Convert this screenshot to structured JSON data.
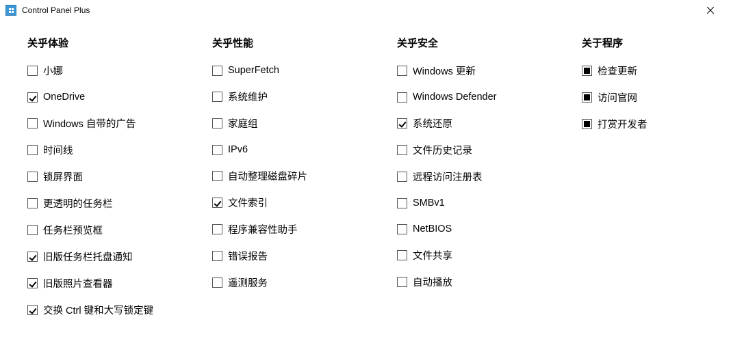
{
  "window": {
    "title": "Control Panel Plus"
  },
  "columns": [
    {
      "header": "关乎体验",
      "items": [
        {
          "label": "小娜",
          "state": "unchecked"
        },
        {
          "label": "OneDrive",
          "state": "checked"
        },
        {
          "label": "Windows 自带的广告",
          "state": "unchecked"
        },
        {
          "label": "时间线",
          "state": "unchecked"
        },
        {
          "label": "锁屏界面",
          "state": "unchecked"
        },
        {
          "label": "更透明的任务栏",
          "state": "unchecked"
        },
        {
          "label": "任务栏预览框",
          "state": "unchecked"
        },
        {
          "label": "旧版任务栏托盘通知",
          "state": "checked"
        },
        {
          "label": "旧版照片查看器",
          "state": "checked"
        },
        {
          "label": "交换 Ctrl 键和大写锁定键",
          "state": "checked"
        }
      ]
    },
    {
      "header": "关乎性能",
      "items": [
        {
          "label": "SuperFetch",
          "state": "unchecked"
        },
        {
          "label": "系统维护",
          "state": "unchecked"
        },
        {
          "label": "家庭组",
          "state": "unchecked"
        },
        {
          "label": "IPv6",
          "state": "unchecked"
        },
        {
          "label": "自动整理磁盘碎片",
          "state": "unchecked"
        },
        {
          "label": "文件索引",
          "state": "checked"
        },
        {
          "label": "程序兼容性助手",
          "state": "unchecked"
        },
        {
          "label": "错误报告",
          "state": "unchecked"
        },
        {
          "label": "遥测服务",
          "state": "unchecked"
        }
      ]
    },
    {
      "header": "关乎安全",
      "items": [
        {
          "label": "Windows 更新",
          "state": "unchecked"
        },
        {
          "label": "Windows Defender",
          "state": "unchecked"
        },
        {
          "label": "系统还原",
          "state": "checked"
        },
        {
          "label": "文件历史记录",
          "state": "unchecked"
        },
        {
          "label": "远程访问注册表",
          "state": "unchecked"
        },
        {
          "label": "SMBv1",
          "state": "unchecked"
        },
        {
          "label": "NetBIOS",
          "state": "unchecked"
        },
        {
          "label": "文件共享",
          "state": "unchecked"
        },
        {
          "label": "自动播放",
          "state": "unchecked"
        }
      ]
    },
    {
      "header": "关于程序",
      "items": [
        {
          "label": "检查更新",
          "state": "square"
        },
        {
          "label": "访问官网",
          "state": "square"
        },
        {
          "label": "打赏开发者",
          "state": "square"
        }
      ]
    }
  ]
}
